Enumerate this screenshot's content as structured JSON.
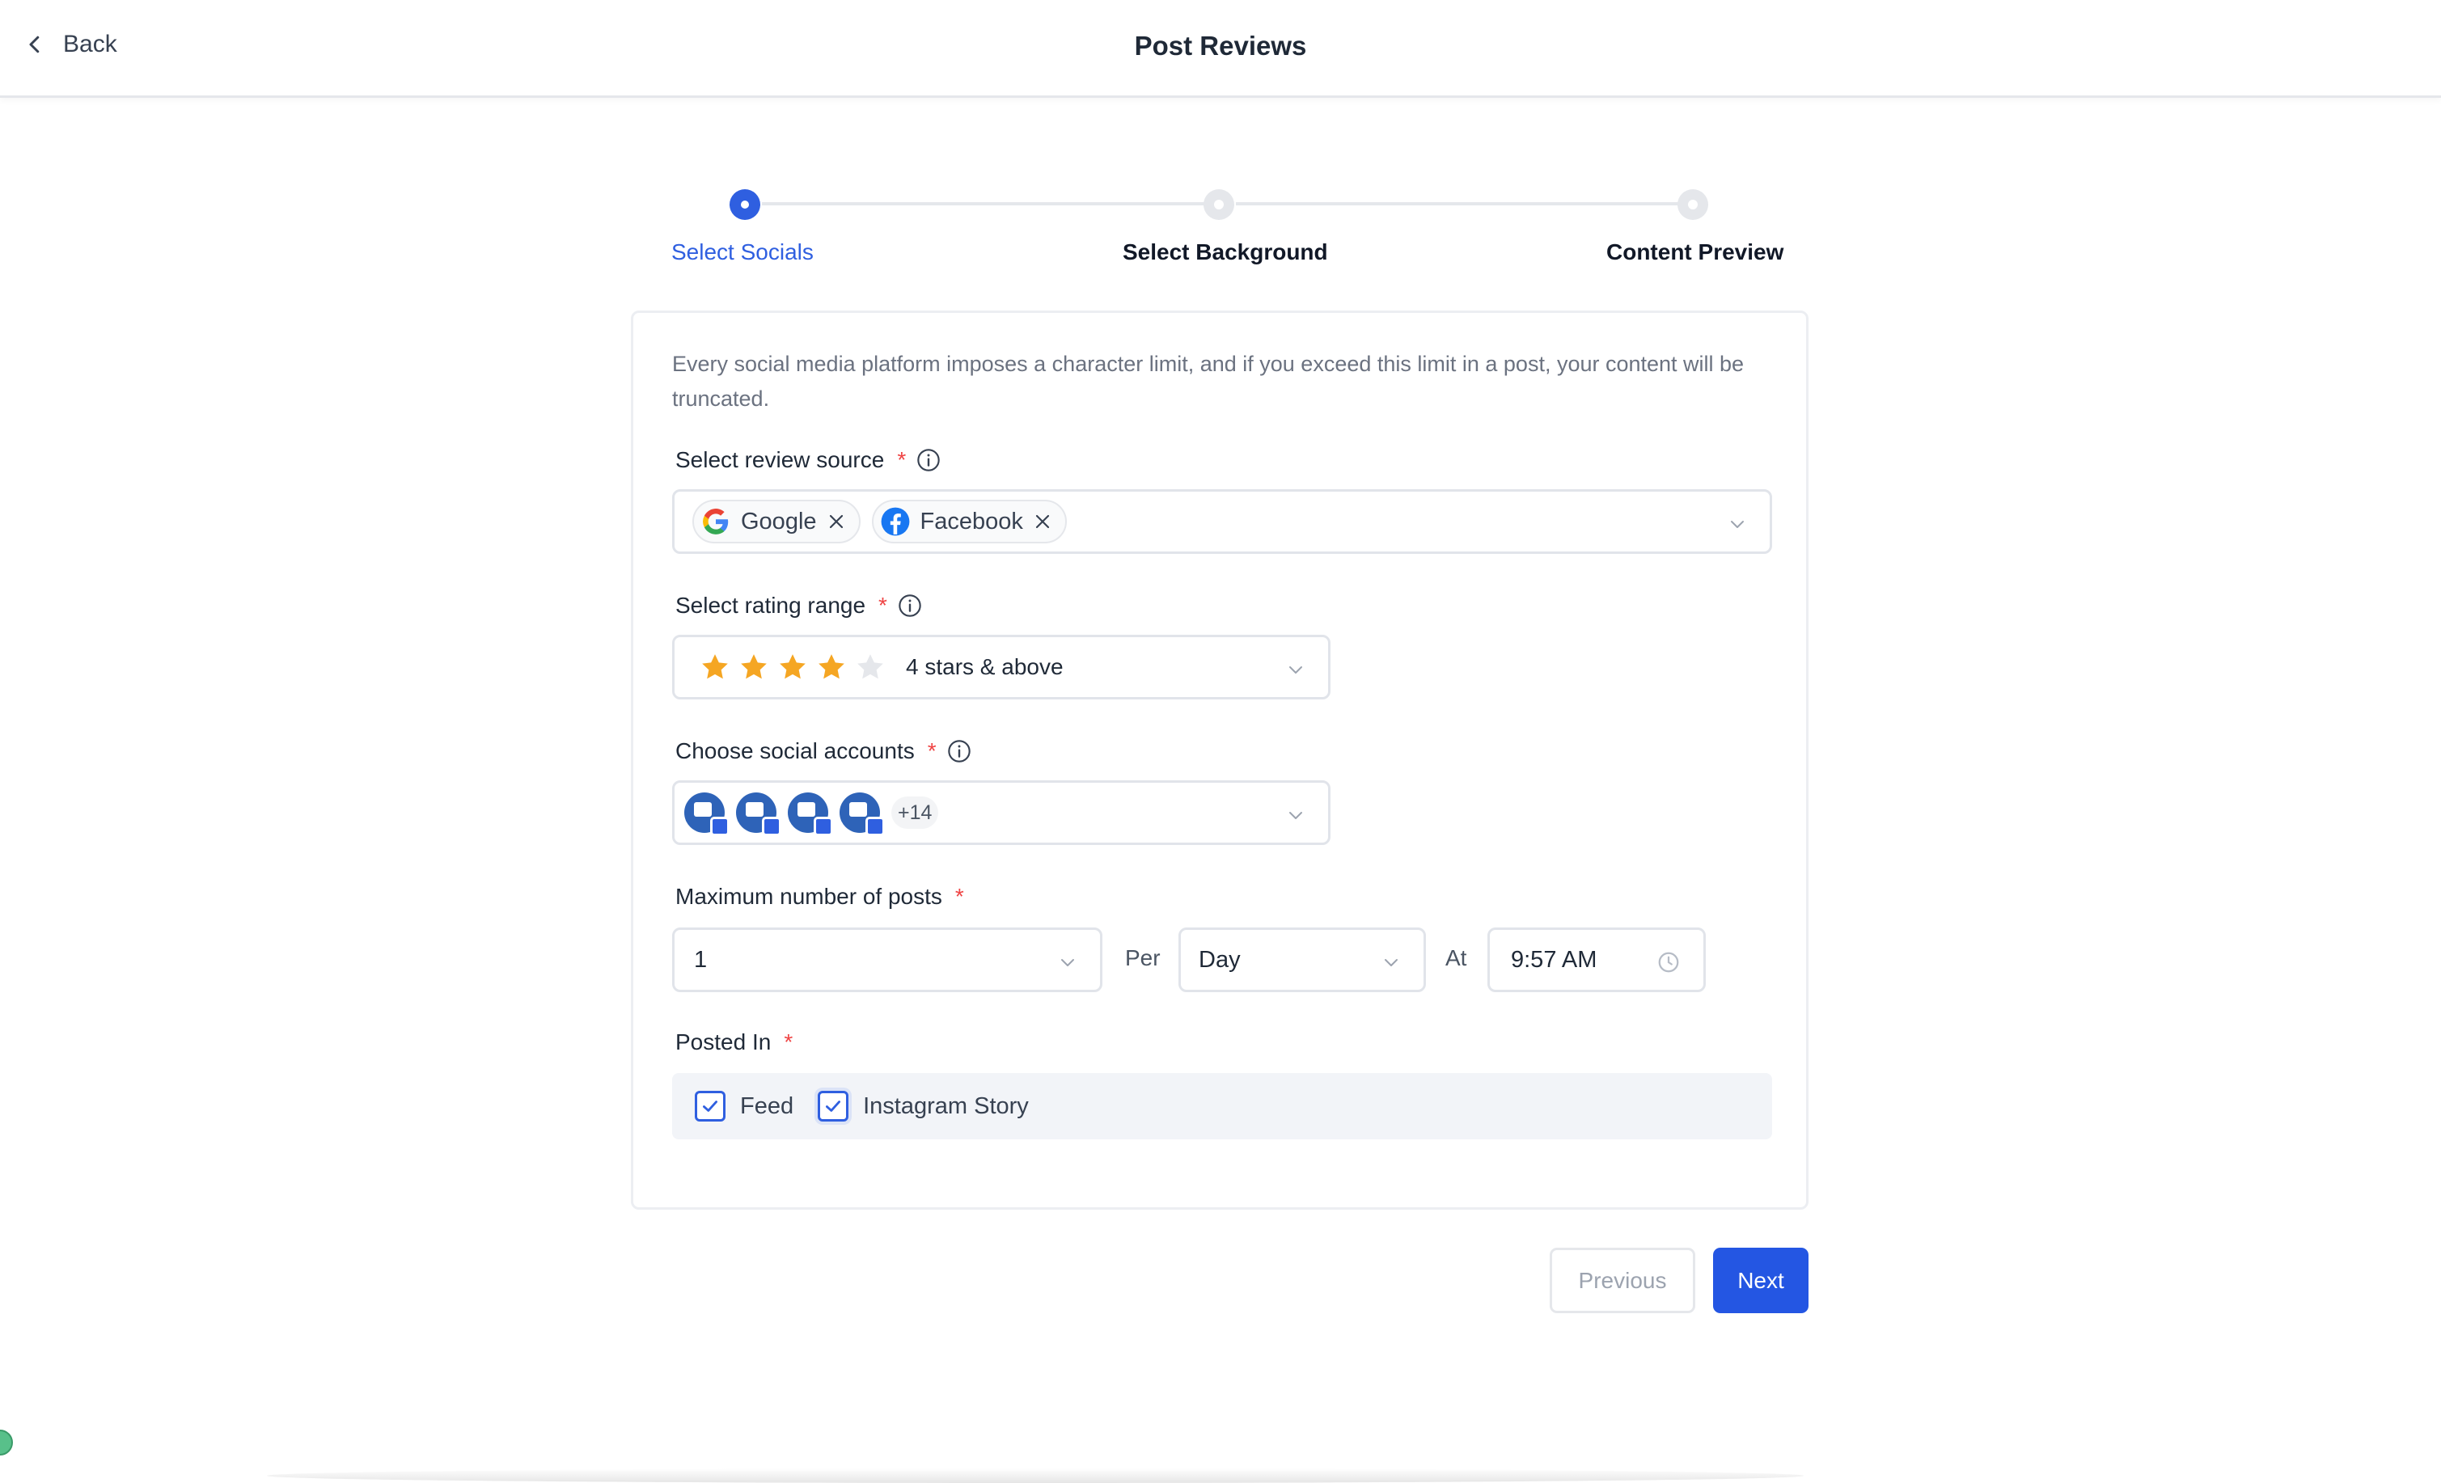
{
  "header": {
    "back_label": "Back",
    "title": "Post Reviews"
  },
  "stepper": {
    "steps": [
      {
        "label": "Select Socials",
        "state": "active"
      },
      {
        "label": "Select Background",
        "state": "inactive"
      },
      {
        "label": "Content Preview",
        "state": "inactive"
      }
    ]
  },
  "card": {
    "info_text": "Every social media platform imposes a character limit, and if you exceed this limit in a post, your content will be truncated.",
    "review_source": {
      "label": "Select review source",
      "required_mark": "*",
      "chips": [
        {
          "label": "Google",
          "icon": "google-logo-icon"
        },
        {
          "label": "Facebook",
          "icon": "facebook-logo-icon"
        }
      ]
    },
    "rating_range": {
      "label": "Select rating range",
      "required_mark": "*",
      "stars_filled": 4,
      "stars_total": 5,
      "value": "4 stars & above"
    },
    "social_accounts": {
      "label": "Choose social accounts",
      "required_mark": "*",
      "visible_avatars": 4,
      "more_count": "+14"
    },
    "max_posts": {
      "label": "Maximum number of posts",
      "required_mark": "*",
      "count_value": "1",
      "per_label": "Per",
      "period_value": "Day",
      "at_label": "At",
      "time_value": "9:57 AM"
    },
    "posted_in": {
      "label": "Posted In",
      "required_mark": "*",
      "options": [
        {
          "label": "Feed",
          "checked": true
        },
        {
          "label": "Instagram Story",
          "checked": true
        }
      ]
    }
  },
  "footer": {
    "previous_label": "Previous",
    "next_label": "Next"
  },
  "colors": {
    "primary": "#2456e3",
    "star": "#f5a623",
    "required": "#ef4444"
  }
}
